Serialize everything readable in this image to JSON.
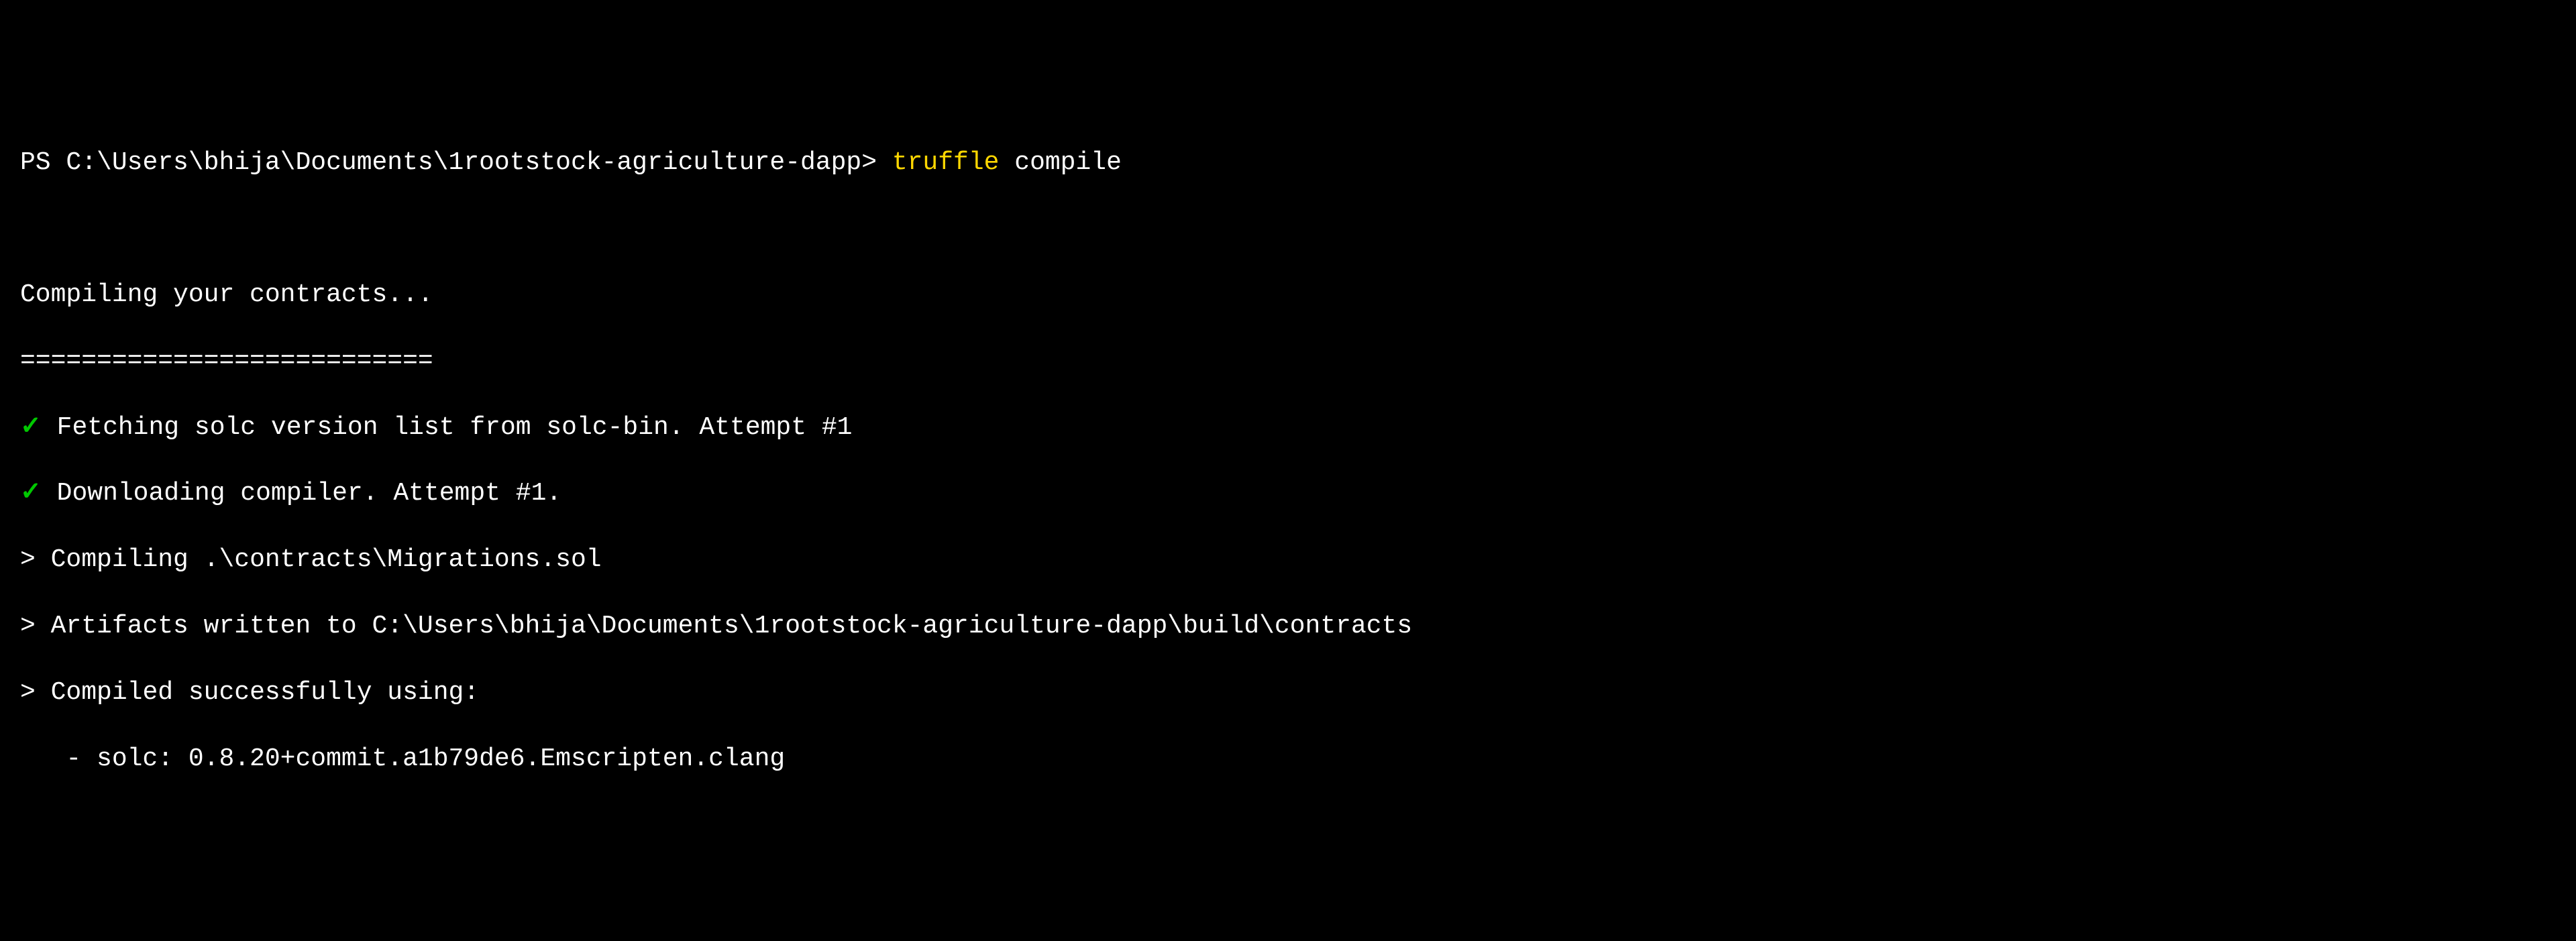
{
  "terminal": {
    "prompt_prefix": "PS ",
    "cwd": "C:\\Users\\bhija\\Documents\\1rootstock-agriculture-dapp",
    "prompt_suffix": "> ",
    "command_highlighted": "truffle",
    "command_rest": " compile",
    "output": {
      "heading": "Compiling your contracts...",
      "separator": "===========================",
      "lines": [
        {
          "marker": "check",
          "text": "Fetching solc version list from solc-bin. Attempt #1"
        },
        {
          "marker": "check",
          "text": "Downloading compiler. Attempt #1."
        },
        {
          "marker": "gt",
          "text": "Compiling .\\contracts\\Migrations.sol"
        },
        {
          "marker": "gt",
          "text": "Artifacts written to C:\\Users\\bhija\\Documents\\1rootstock-agriculture-dapp\\build\\contracts"
        },
        {
          "marker": "gt",
          "text": "Compiled successfully using:"
        }
      ],
      "indent_line": "   - solc: 0.8.20+commit.a1b79de6.Emscripten.clang"
    }
  },
  "markers": {
    "check": "✓",
    "gt": ">"
  }
}
